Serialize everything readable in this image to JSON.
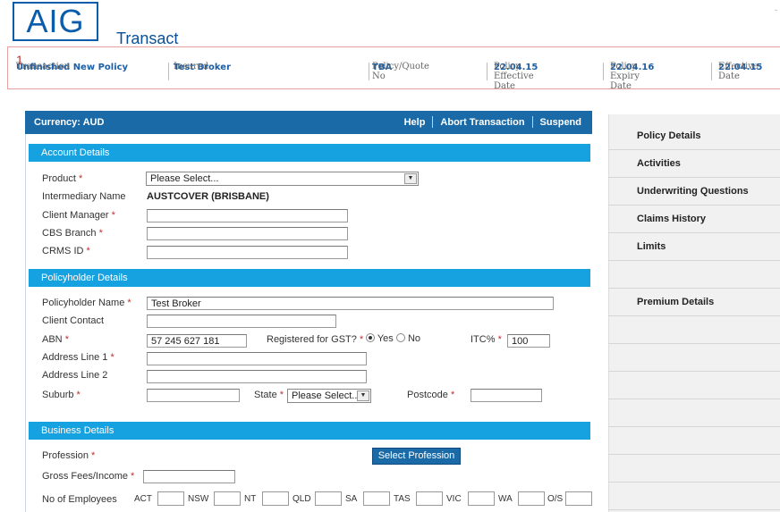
{
  "app": {
    "logo_text": "AIG",
    "title": "Transact",
    "corner_mark": "-"
  },
  "summary": {
    "index": "1",
    "columns": [
      {
        "label": "Transaction",
        "value": "Unfinished New Policy"
      },
      {
        "label": "Insured:",
        "value": "Test Broker"
      },
      {
        "label": "Policy/Quote No",
        "value": "TBA"
      },
      {
        "label": "Policy Effective Date",
        "value": "22.04.15"
      },
      {
        "label": "Policy Expiry Date",
        "value": "22.04.16"
      },
      {
        "label": "Effective Date",
        "value": "22.04.15"
      }
    ]
  },
  "header": {
    "currency": "Currency: AUD",
    "links": [
      "Help",
      "Abort Transaction",
      "Suspend"
    ]
  },
  "account": {
    "title": "Account Details",
    "product_label": "Product",
    "product_value": "Please Select...",
    "intermediary_label": "Intermediary Name",
    "intermediary_value": "AUSTCOVER (BRISBANE)",
    "client_manager_label": "Client Manager",
    "cbs_branch_label": "CBS Branch",
    "crms_id_label": "CRMS ID"
  },
  "policyholder": {
    "title": "Policyholder Details",
    "name_label": "Policyholder Name",
    "name_value": "Test Broker",
    "contact_label": "Client Contact",
    "abn_label": "ABN",
    "abn_value": "57 245 627 181",
    "gst_label": "Registered for GST?",
    "gst_yes": "Yes",
    "gst_no": "No",
    "itc_label": "ITC%",
    "itc_value": "100",
    "addr1_label": "Address Line 1",
    "addr2_label": "Address Line 2",
    "suburb_label": "Suburb",
    "state_label": "State",
    "state_value": "Please Select...",
    "postcode_label": "Postcode"
  },
  "business": {
    "title": "Business Details",
    "profession_label": "Profession",
    "select_profession": "Select Profession",
    "gross_fees_label": "Gross Fees/Income",
    "employees_label": "No of Employees",
    "states": [
      "ACT",
      "NSW",
      "NT",
      "QLD",
      "SA",
      "TAS",
      "VIC",
      "WA",
      "O/S"
    ]
  },
  "side_nav": [
    "Policy Details",
    "Activities",
    "Underwriting Questions",
    "Claims History",
    "Limits",
    "",
    "Premium Details"
  ],
  "required_mark": "*"
}
